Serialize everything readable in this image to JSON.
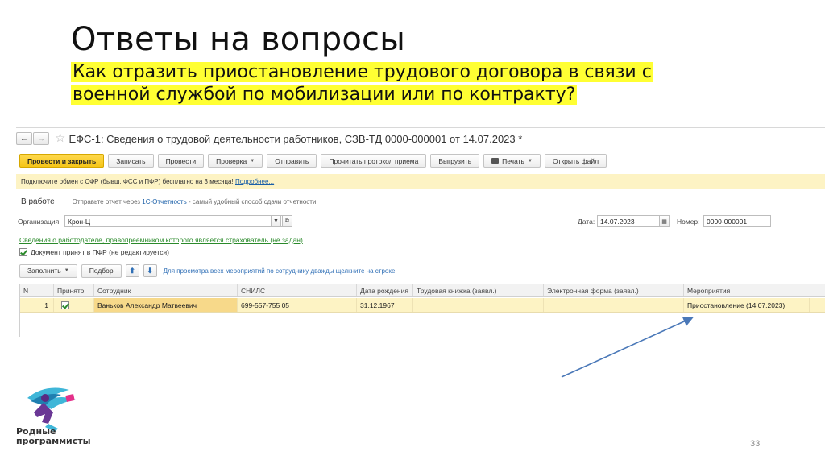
{
  "slide": {
    "title": "Ответы на вопросы",
    "subtitle": "Как отразить приостановление трудового договора в связи с военной службой по мобилизации или по контракту?",
    "page_number": "33",
    "logo_text_line1": "Родные",
    "logo_text_line2": "программисты"
  },
  "window": {
    "back_icon": "arrow-left",
    "forward_icon": "arrow-right",
    "star_icon": "star",
    "title": "ЕФС-1: Сведения о трудовой деятельности работников, СЗВ-ТД 0000-000001 от 14.07.2023 *"
  },
  "toolbar": {
    "post_close": "Провести и закрыть",
    "save": "Записать",
    "post": "Провести",
    "check": "Проверка",
    "send": "Отправить",
    "read_protocol": "Прочитать протокол приема",
    "upload": "Выгрузить",
    "print": "Печать",
    "open_file": "Открыть файл"
  },
  "notice": {
    "text": "Подключите обмен с СФР (бывш. ФСС и ПФР) бесплатно на 3 месяца!",
    "link": "Подробнее..."
  },
  "status": {
    "state": "В работе",
    "text_before": "Отправьте отчет через",
    "link": "1С-Отчетность",
    "text_after": "- самый удобный способ сдачи отчетности."
  },
  "fields": {
    "org_label": "Организация:",
    "org_value": "Крон-Ц",
    "date_label": "Дата:",
    "date_value": "14.07.2023",
    "number_label": "Номер:",
    "number_value": "0000-000001"
  },
  "employer_link": "Сведения о работодателе, правопреемником которого является страхователь (не задан)",
  "accepted_checkbox": "Документ принят в ПФР (не редактируется)",
  "table_tools": {
    "fill": "Заполнить",
    "select": "Подбор",
    "hint": "Для просмотра всех мероприятий по сотруднику дважды щелкните на строке."
  },
  "table": {
    "columns": [
      "N",
      "Принято",
      "Сотрудник",
      "СНИЛС",
      "Дата рождения",
      "Трудовая книжка (заявл.)",
      "Электронная форма (заявл.)",
      "Мероприятия"
    ],
    "rows": [
      {
        "n": "1",
        "accepted": true,
        "employee": "Ваньков Александр Матвеевич",
        "snils": "699-557-755 05",
        "birth_date": "31.12.1967",
        "work_book": "",
        "electronic_form": "",
        "events": "Приостановление (14.07.2023)"
      }
    ]
  },
  "colors": {
    "highlight": "#ffff33",
    "primary_button": "#f5c518",
    "notice_bg": "#fdf3c4",
    "arrow": "#4a78b8"
  }
}
